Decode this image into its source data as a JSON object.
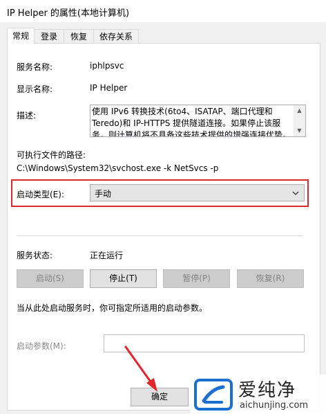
{
  "window": {
    "title": "IP Helper 的属性(本地计算机)"
  },
  "tabs": [
    {
      "label": "常规",
      "active": true
    },
    {
      "label": "登录",
      "active": false
    },
    {
      "label": "恢复",
      "active": false
    },
    {
      "label": "依存关系",
      "active": false
    }
  ],
  "general": {
    "service_name_label": "服务名称:",
    "service_name_value": "iphlpsvc",
    "display_name_label": "显示名称:",
    "display_name_value": "IP Helper",
    "description_label": "描述:",
    "description_value": "使用 IPv6 转换技术(6to4、ISATAP、端口代理和 Teredo)和 IP-HTTPS 提供隧道连接。如果停止该服务，则计算机将不具备这些技术提供的增强连接优势。",
    "exe_path_label": "可执行文件的路径:",
    "exe_path_value": "C:\\Windows\\System32\\svchost.exe -k NetSvcs -p",
    "startup_type_label": "启动类型(E):",
    "startup_type_value": "手动",
    "status_label": "服务状态:",
    "status_value": "正在运行",
    "buttons": {
      "start": "启动(S)",
      "stop": "停止(T)",
      "pause": "暂停(P)",
      "resume": "恢复(R)"
    },
    "hint_text": "当从此处启动服务时，你可指定所适用的启动参数。",
    "start_params_label": "启动参数(M):",
    "start_params_value": ""
  },
  "footer": {
    "ok_label": "确定"
  },
  "watermark": {
    "text": "爱纯净",
    "url": "aichunjing.com"
  },
  "colors": {
    "highlight": "#e0262a",
    "arrow": "#e0262a",
    "logo": "#1a6fd0"
  }
}
